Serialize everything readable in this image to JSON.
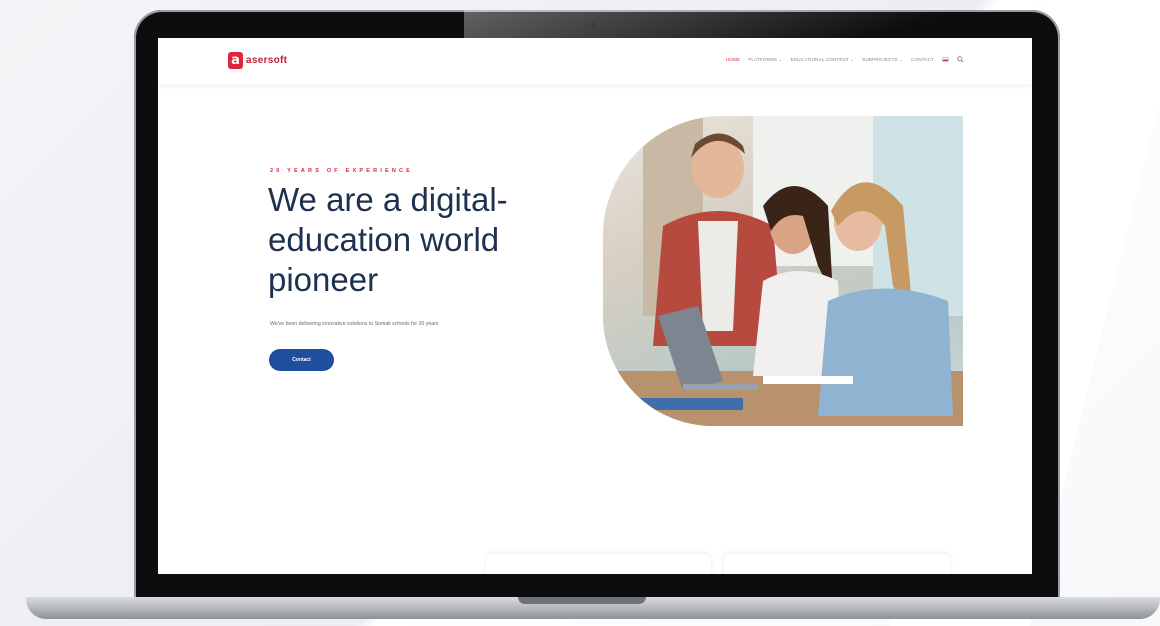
{
  "header": {
    "logo_letter": "a",
    "logo_text": "asersoft",
    "nav": [
      {
        "label": "HOME",
        "active": true
      },
      {
        "label": "PLATFORMS ⌄",
        "active": false
      },
      {
        "label": "EDUCATIONAL CONTENT ⌄",
        "active": false
      },
      {
        "label": "SUBPROJECTS ⌄",
        "active": false
      },
      {
        "label": "CONTACT",
        "active": false
      }
    ],
    "language_flag": "tr-flag-icon",
    "search_icon": "search-icon"
  },
  "hero": {
    "eyebrow": "20 YEARS OF EXPERIENCE",
    "headline_line1": "We are a digital-",
    "headline_line2": "education world",
    "headline_line3": "pioneer",
    "subline": "We've been delivering innovative solutions to Somali schools for 20 years",
    "cta_label": "Contact"
  },
  "colors": {
    "accent_red": "#e0253a",
    "brand_blue": "#1f4e9c",
    "headline": "#1f3150"
  }
}
